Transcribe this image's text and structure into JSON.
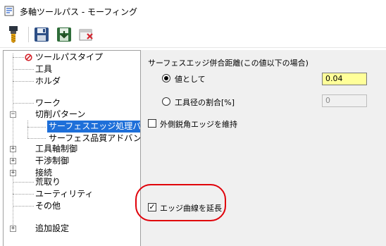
{
  "window": {
    "title": "多軸ツールパス - モーフィング"
  },
  "toolbar": {
    "icons": [
      "tool-icon",
      "save-icon",
      "save-and-calculate-icon",
      "cancel-icon"
    ]
  },
  "tree": {
    "items": [
      {
        "label": "ツールパスタイプ"
      },
      {
        "label": "工具"
      },
      {
        "label": "ホルダ"
      },
      {
        "label": "ワーク"
      },
      {
        "label": "切削パターン",
        "expander": "−"
      },
      {
        "label": "サーフェスエッジ処理パラメタ",
        "selected": true
      },
      {
        "label": "サーフェス品質アドバンスオプ"
      },
      {
        "label": "工具軸制御",
        "expander": "+"
      },
      {
        "label": "干渉制御",
        "expander": "+"
      },
      {
        "label": "接続",
        "expander": "+"
      },
      {
        "label": "荒取り"
      },
      {
        "label": "ユーティリティ"
      },
      {
        "label": "その他"
      },
      {
        "label": "追加設定",
        "expander": "+"
      }
    ]
  },
  "panel": {
    "group_label": "サーフェスエッジ併合距離(この値以下の場合)",
    "radio_value_label": "値として",
    "value_input": "0.04",
    "radio_ratio_label": "工具径の割合[%]",
    "ratio_input": "0",
    "keep_sharp_label": "外側鋭角エッジを維持",
    "extend_edge_label": "エッジ曲線を延長",
    "extend_edge_check": "✓"
  },
  "colors": {
    "selection": "#1e6fd9",
    "panel_bg": "#f0f0f0",
    "input_highlight": "#ffff99",
    "annotation": "#e0000a"
  }
}
